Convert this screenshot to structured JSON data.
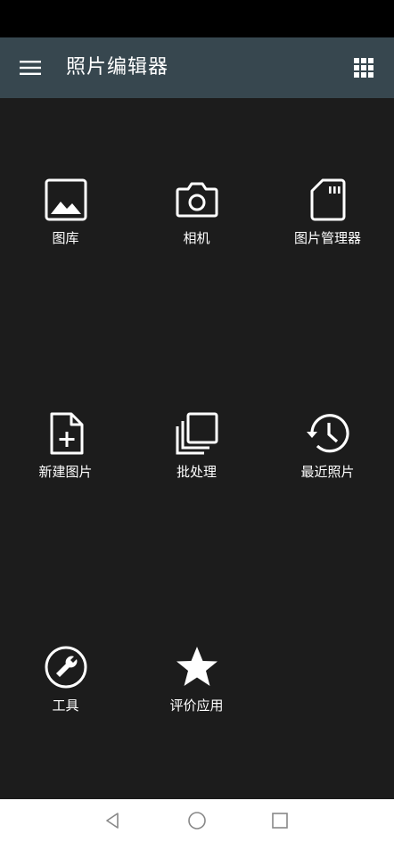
{
  "app_bar": {
    "title": "照片编辑器",
    "menu_icon": "hamburger-menu-icon",
    "apps_icon": "grid-apps-icon",
    "color": "#37474f"
  },
  "tiles": [
    {
      "label": "图库",
      "icon": "image-icon"
    },
    {
      "label": "相机",
      "icon": "camera-icon"
    },
    {
      "label": "图片管理器",
      "icon": "sd-card-icon"
    },
    {
      "label": "新建图片",
      "icon": "new-file-icon"
    },
    {
      "label": "批处理",
      "icon": "batch-copy-icon"
    },
    {
      "label": "最近照片",
      "icon": "history-icon"
    },
    {
      "label": "工具",
      "icon": "wrench-icon"
    },
    {
      "label": "评价应用",
      "icon": "star-icon"
    }
  ],
  "nav": {
    "back_icon": "back-triangle-icon",
    "home_icon": "home-circle-icon",
    "recents_icon": "recents-square-icon"
  },
  "colors": {
    "background": "#1c1c1c",
    "status_bar": "#000000",
    "nav_bar": "#ffffff",
    "icon": "#ffffff"
  }
}
